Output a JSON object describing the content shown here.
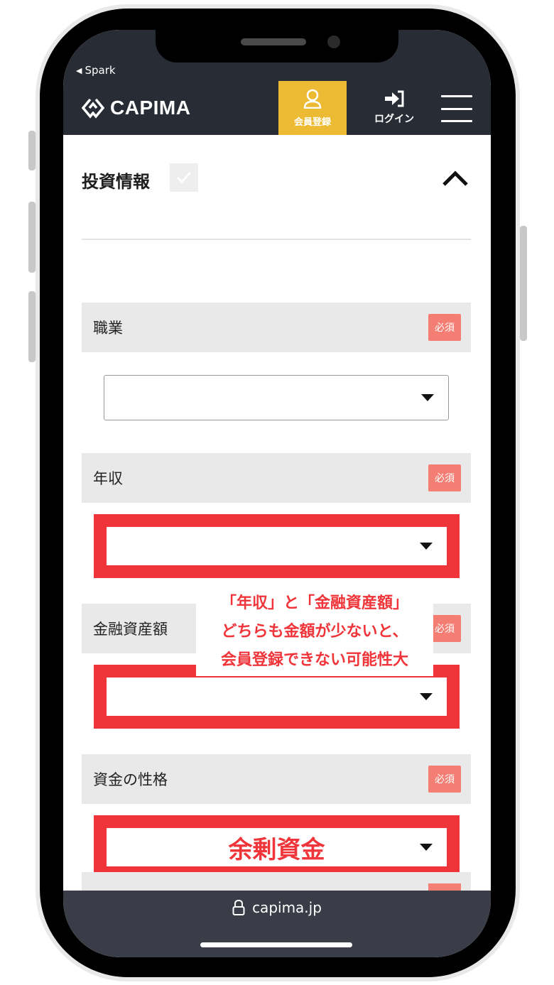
{
  "status_bar": {
    "back_app": "Spark"
  },
  "header": {
    "brand": "CAPIMA",
    "register_label": "会員登録",
    "login_label": "ログイン",
    "colors": {
      "header_bg": "#282c34",
      "register_bg": "#ecbb33"
    }
  },
  "section": {
    "title": "投資情報"
  },
  "fields": [
    {
      "label": "職業",
      "required": "必須",
      "value": ""
    },
    {
      "label": "年収",
      "required": "必須",
      "value": ""
    },
    {
      "label": "金融資産額",
      "required": "必須",
      "value": ""
    },
    {
      "label": "資金の性格",
      "required": "必須",
      "value": "余剰資金"
    }
  ],
  "annotation": {
    "line1": "「年収」と「金融資産額」",
    "line2": "どちらも金額が少ないと、",
    "line3": "会員登録できない可能性大",
    "color": "#f0353a"
  },
  "url_bar": {
    "url": "capima.jp"
  },
  "icons": [
    "back-triangle-icon",
    "capima-logo-icon",
    "person-icon",
    "login-arrow-icon",
    "hamburger-menu-icon",
    "check-icon",
    "chevron-up-icon",
    "dropdown-arrow-icon",
    "lock-icon"
  ]
}
